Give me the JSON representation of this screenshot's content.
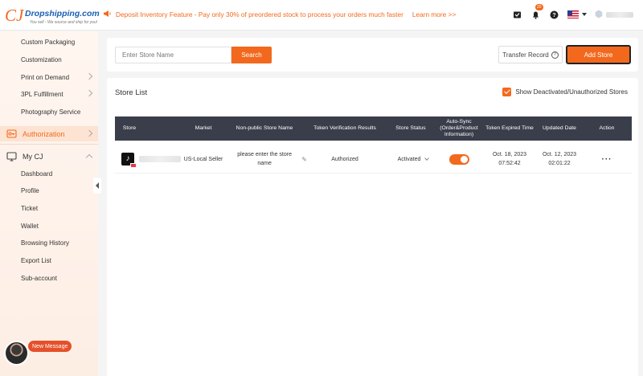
{
  "brand": {
    "logo_mark": "CJ",
    "name": "Dropshipping.com",
    "tagline": "You sell - We source and ship for you!",
    "brand_color": "#f2691e"
  },
  "announcement": {
    "icon": "megaphone-icon",
    "text": "Deposit Inventory Feature - Pay only 30% of preordered stock to process your orders much faster",
    "link": "Learn more >>"
  },
  "header_icons": {
    "cart_icon": "cart-icon",
    "bell_badge": "20",
    "help_icon": "help-icon",
    "flag": "us-flag-icon"
  },
  "sidebar": {
    "items_top": [
      "Custom Packaging",
      "Customization",
      "Print on Demand",
      "3PL Fulfillment",
      "Photography Service"
    ],
    "authorization": "Authorization",
    "my_cj": "My CJ",
    "my_cj_items": [
      "Dashboard",
      "Profile",
      "Ticket",
      "Wallet",
      "Browsing History",
      "Export List",
      "Sub-account"
    ]
  },
  "chat": {
    "new_message": "New Message"
  },
  "toolbar": {
    "search_placeholder": "Enter Store Name",
    "search_label": "Search",
    "transfer_label": "Transfer Record",
    "add_store_label": "Add Store"
  },
  "store_list": {
    "title": "Store List",
    "show_deactivated_label": "Show Deactivated/Unauthorized Stores",
    "show_deactivated_checked": true,
    "columns": {
      "store": "Store",
      "market": "Market",
      "name": "Non-public Store Name",
      "token": "Token Verification Results",
      "status": "Store Status",
      "autosync_1": "Auto-Sync",
      "autosync_2": "(Order&Product",
      "autosync_3": "Information)",
      "expired": "Token Expired Time",
      "updated": "Updated Date",
      "action": "Action"
    },
    "rows": [
      {
        "platform_icon": "tiktok-icon",
        "market": "US-Local Seller",
        "name_placeholder": "please enter the store name",
        "token_result": "Authorized",
        "status": "Activated",
        "auto_sync_on": true,
        "expired_date": "Oct. 18, 2023",
        "expired_time": "07:52:42",
        "updated_date": "Oct. 12, 2023",
        "updated_time": "02:01:22",
        "action": "···"
      }
    ]
  }
}
